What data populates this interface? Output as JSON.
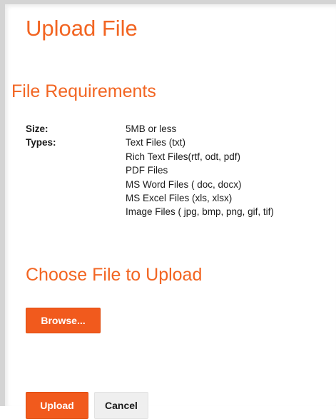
{
  "page": {
    "title": "Upload File"
  },
  "requirements": {
    "heading": "File Requirements",
    "size_label": "Size:",
    "size_value": "5MB or less",
    "types_label": "Types:",
    "types": [
      "Text Files (txt)",
      "Rich Text Files(rtf, odt, pdf)",
      "PDF Files",
      "MS Word Files ( doc, docx)",
      "MS Excel Files (xls, xlsx)",
      "Image Files ( jpg, bmp, png, gif, tif)"
    ]
  },
  "upload": {
    "heading": "Choose File to Upload",
    "browse_label": "Browse..."
  },
  "actions": {
    "upload_label": "Upload",
    "cancel_label": "Cancel"
  },
  "colors": {
    "accent": "#f26522",
    "button_primary": "#f15a1d",
    "button_secondary": "#efefef",
    "frame_border": "#d4d4d4"
  }
}
